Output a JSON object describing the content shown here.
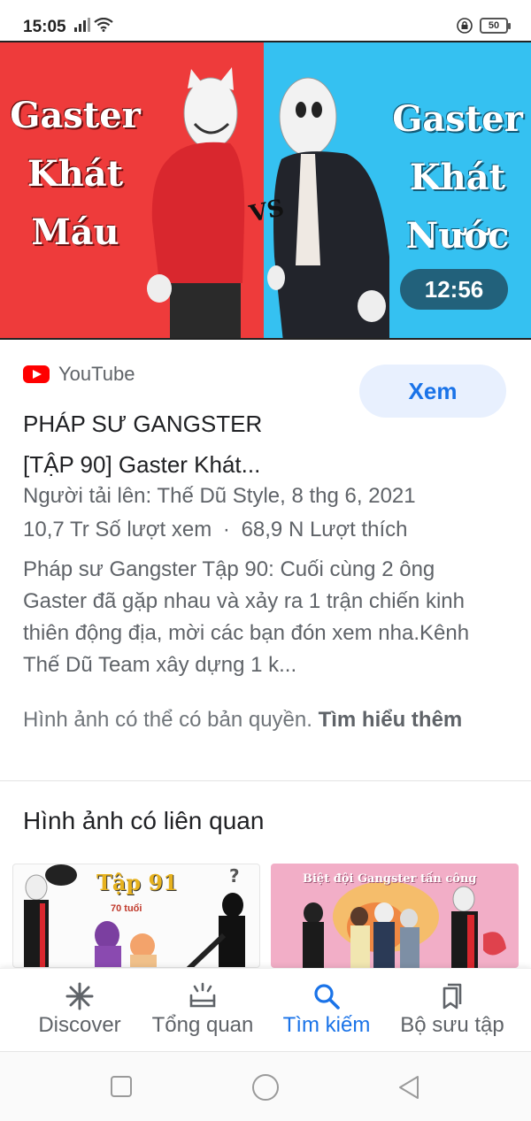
{
  "status_bar": {
    "time": "15:05",
    "battery": "50"
  },
  "thumbnail": {
    "left_title": [
      "Gaster",
      "Khát",
      "Máu"
    ],
    "right_title": [
      "Gaster",
      "Khát",
      "Nước"
    ],
    "vs": "VS",
    "duration": "12:56",
    "left_color": "#ee3b3b",
    "right_color": "#35c1f1"
  },
  "result": {
    "source_icon": "youtube-icon",
    "source_name": "YouTube",
    "watch_label": "Xem",
    "title_line1": "PHÁP SƯ GANGSTER",
    "title_line2": "[TẬP 90] Gaster Khát...",
    "uploader": "Người tải lên: Thế Dũ Style, 8 thg 6, 2021",
    "views": "10,7 Tr Số lượt xem",
    "separator": "·",
    "likes": "68,9 N Lượt thích",
    "description": "Pháp sư Gangster Tập 90: Cuối cùng 2 ông Gaster đã gặp nhau và xảy ra 1 trận chiến kinh thiên động địa, mời các bạn đón xem nha.Kênh Thế Dũ Team xây dựng 1 k...",
    "copyright_text": "Hình ảnh có thể có bản quyền.",
    "learn_more": "Tìm hiểu thêm"
  },
  "related": {
    "heading": "Hình ảnh có liên quan",
    "items": [
      {
        "caption": "Tập 91",
        "subcaption": "70 tuổi"
      },
      {
        "caption": "Biệt đội Gangster tấn công"
      }
    ]
  },
  "bottom_nav": {
    "items": [
      {
        "label": "Discover",
        "icon": "asterisk-icon"
      },
      {
        "label": "Tổng quan",
        "icon": "overview-icon"
      },
      {
        "label": "Tìm kiếm",
        "icon": "search-icon"
      },
      {
        "label": "Bộ sưu tập",
        "icon": "collections-icon"
      }
    ],
    "active": "Tìm kiếm",
    "active_color": "#1a73e8"
  }
}
